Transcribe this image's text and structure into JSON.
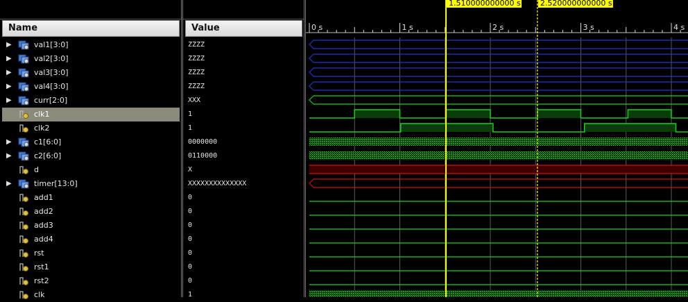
{
  "columns": {
    "name": "Name",
    "value": "Value"
  },
  "signals": [
    {
      "name": "val1[3:0]",
      "value": "ZZZZ",
      "bus": true,
      "selected": false
    },
    {
      "name": "val2[3:0]",
      "value": "ZZZZ",
      "bus": true,
      "selected": false
    },
    {
      "name": "val3[3:0]",
      "value": "ZZZZ",
      "bus": true,
      "selected": false
    },
    {
      "name": "val4[3:0]",
      "value": "ZZZZ",
      "bus": true,
      "selected": false
    },
    {
      "name": "curr[2:0]",
      "value": "XXX",
      "bus": true,
      "selected": false
    },
    {
      "name": "clk1",
      "value": "1",
      "bus": false,
      "selected": true
    },
    {
      "name": "clk2",
      "value": "1",
      "bus": false,
      "selected": false
    },
    {
      "name": "c1[6:0]",
      "value": "0000000",
      "bus": true,
      "selected": false
    },
    {
      "name": "c2[6:0]",
      "value": "0110000",
      "bus": true,
      "selected": false
    },
    {
      "name": "d",
      "value": "X",
      "bus": false,
      "selected": false
    },
    {
      "name": "timer[13:0]",
      "value": "XXXXXXXXXXXXXX",
      "bus": true,
      "selected": false
    },
    {
      "name": "add1",
      "value": "0",
      "bus": false,
      "selected": false
    },
    {
      "name": "add2",
      "value": "0",
      "bus": false,
      "selected": false
    },
    {
      "name": "add3",
      "value": "0",
      "bus": false,
      "selected": false
    },
    {
      "name": "add4",
      "value": "0",
      "bus": false,
      "selected": false
    },
    {
      "name": "rst",
      "value": "0",
      "bus": false,
      "selected": false
    },
    {
      "name": "rst1",
      "value": "0",
      "bus": false,
      "selected": false
    },
    {
      "name": "rst2",
      "value": "0",
      "bus": false,
      "selected": false
    },
    {
      "name": "clk",
      "value": "1",
      "bus": false,
      "selected": false
    }
  ],
  "ruler": {
    "ticks": [
      "0 s",
      "1 s",
      "2 s",
      "3 s",
      "4 s"
    ],
    "tick_values_s": [
      0,
      1,
      2,
      3,
      4
    ]
  },
  "cursors": [
    {
      "label": "1.510000000000 s",
      "time_s": 1.51,
      "style": "solid"
    },
    {
      "label": "2.520000000000 s",
      "time_s": 2.52,
      "style": "dashed"
    }
  ],
  "colors": {
    "bus_z": "#2233cc",
    "wave_green": "#18d018",
    "wave_red": "#cc1111",
    "clk_fill": "#0b3d0b",
    "cursor": "#ffff00",
    "grid": "#5a5a5a"
  },
  "clk1_high_intervals_s": [
    [
      0.5,
      1.0
    ],
    [
      1.51,
      2.0
    ],
    [
      2.52,
      3.0
    ],
    [
      3.52,
      4.0
    ]
  ],
  "clk2_high_intervals_s": [
    [
      1.01,
      2.03
    ],
    [
      3.04,
      4.05
    ]
  ],
  "icons": {
    "bus": "bus-icon",
    "bit": "bit-icon",
    "expander": "expand-arrow-icon"
  }
}
